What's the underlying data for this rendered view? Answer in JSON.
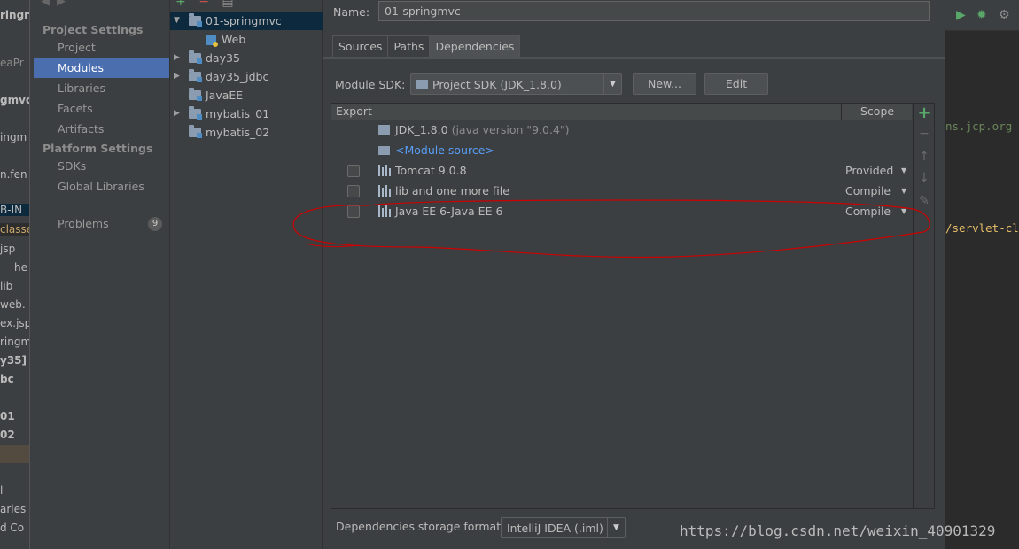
{
  "background_left": {
    "fragments": [
      "ringr",
      "eaPr",
      "gmvc",
      "ingm",
      "n.fen",
      "B-IN",
      "classe",
      "jsp",
      "he",
      "lib",
      "web.",
      "ex.jsp",
      "ringm",
      "y35]",
      "bc",
      "01",
      "02",
      "l",
      "aries",
      "d Co"
    ]
  },
  "background_right": {
    "code_lines": [
      "ns.jcp.org",
      "/servlet-cl"
    ]
  },
  "nav": {
    "project_settings_header": "Project Settings",
    "platform_settings_header": "Platform Settings",
    "items": [
      {
        "label": "Project",
        "selected": false
      },
      {
        "label": "Modules",
        "selected": true
      },
      {
        "label": "Libraries",
        "selected": false
      },
      {
        "label": "Facets",
        "selected": false
      },
      {
        "label": "Artifacts",
        "selected": false
      }
    ],
    "platform_items": [
      {
        "label": "SDKs"
      },
      {
        "label": "Global Libraries"
      }
    ],
    "problems_label": "Problems",
    "problems_count": "9"
  },
  "tree": {
    "modules": [
      {
        "label": "01-springmvc",
        "expanded": true,
        "selected": true
      },
      {
        "label": "Web",
        "child": true
      },
      {
        "label": "day35",
        "expanded": false
      },
      {
        "label": "day35_jdbc",
        "expanded": false
      },
      {
        "label": "JavaEE",
        "leaf": true
      },
      {
        "label": "mybatis_01",
        "expanded": false
      },
      {
        "label": "mybatis_02",
        "leaf": true
      }
    ]
  },
  "panel": {
    "name_label": "Name:",
    "name_value": "01-springmvc",
    "tabs": [
      {
        "label": "Sources",
        "active": false
      },
      {
        "label": "Paths",
        "active": false
      },
      {
        "label": "Dependencies",
        "active": true
      }
    ],
    "sdk_label": "Module SDK:",
    "sdk_value": "Project SDK (JDK_1.8.0)",
    "new_button": "New...",
    "edit_button": "Edit",
    "table_header": {
      "export": "Export",
      "scope": "Scope"
    },
    "dependencies": [
      {
        "name": "JDK_1.8.0",
        "extra": "(java version \"9.0.4\")",
        "icon": "folder-icon",
        "checkbox": false,
        "scope": ""
      },
      {
        "name": "<Module source>",
        "extra": "",
        "icon": "source-folder-icon",
        "checkbox": false,
        "scope": "",
        "link": true
      },
      {
        "name": "Tomcat 9.0.8",
        "extra": "",
        "icon": "library-icon",
        "checkbox": true,
        "scope": "Provided"
      },
      {
        "name": "lib and one more file",
        "extra": "",
        "icon": "library-icon",
        "checkbox": true,
        "scope": "Compile"
      },
      {
        "name": "Java EE 6-Java EE 6",
        "extra": "",
        "icon": "library-icon",
        "checkbox": true,
        "scope": "Compile"
      }
    ],
    "storage_label": "Dependencies storage format:",
    "storage_value": "IntelliJ IDEA (.iml)"
  },
  "watermark": "https://blog.csdn.net/weixin_40901329",
  "colors": {
    "selection": "#4b6eaf",
    "tree_selection": "#0d293e",
    "link": "#589df6",
    "add": "#59a869",
    "annotation": "#cc0000"
  }
}
